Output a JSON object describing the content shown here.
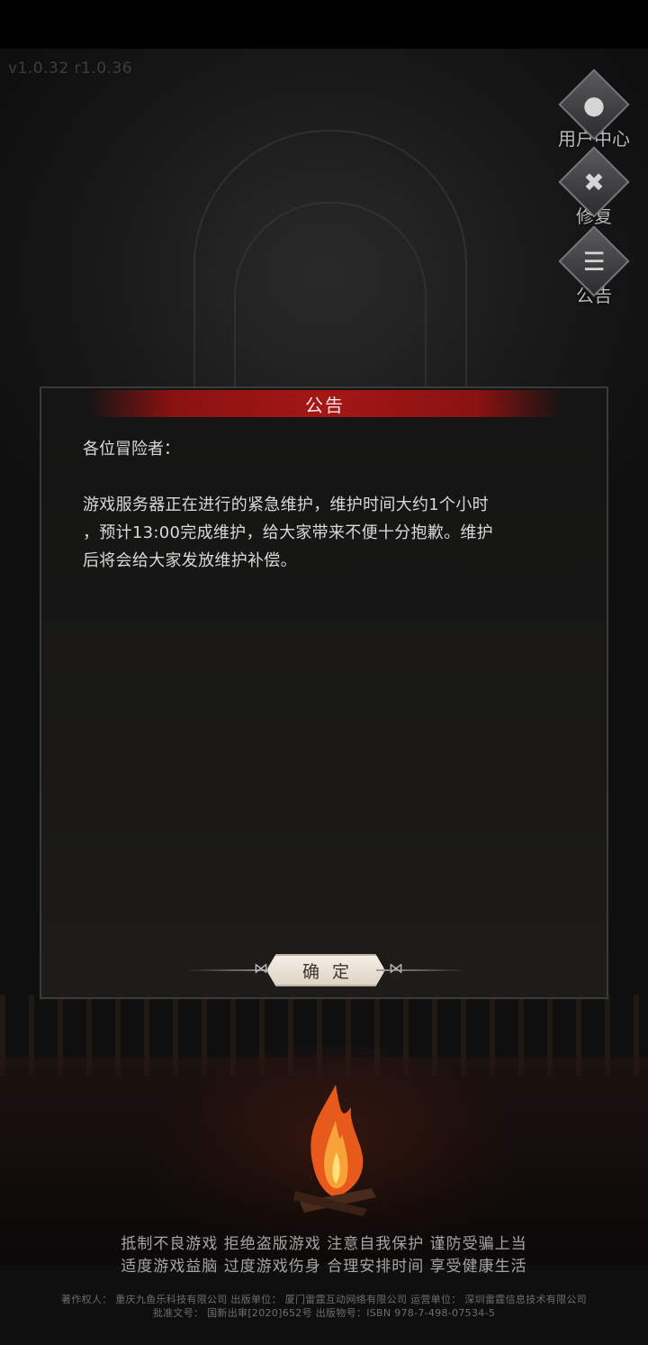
{
  "version": "v1.0.32 r1.0.36",
  "side_menu": {
    "user_center": {
      "label": "用户中心",
      "icon": "user-icon"
    },
    "repair": {
      "label": "修复",
      "icon": "wrench-hammer-icon"
    },
    "announcement": {
      "label": "公告",
      "icon": "document-icon"
    }
  },
  "dialog": {
    "title": "公告",
    "greeting": "各位冒险者：",
    "message_lines": [
      "游戏服务器正在进行的紧急维护，维护时间大约1个小时",
      "，预计13:00完成维护，给大家带来不便十分抱歉。维护",
      "后将会给大家发放维护补偿。"
    ],
    "confirm_label": "确定"
  },
  "health_notice": {
    "line1": "抵制不良游戏  拒绝盗版游戏  注意自我保护  谨防受骗上当",
    "line2": "适度游戏益脑  过度游戏伤身  合理安排时间  享受健康生活"
  },
  "credits": {
    "line1": "著作权人：  重庆九鱼乐科技有限公司  出版单位：  厦门雷霆互动网络有限公司  运营单位：  深圳雷霆信息技术有限公司",
    "line2": "批准文号：  国新出审[2020]652号  出版物号：ISBN 978-7-498-07534-5"
  },
  "colors": {
    "header_red": "#a51616",
    "dialog_bg": "#1a1917",
    "confirm_bg": "#f4efe6"
  }
}
